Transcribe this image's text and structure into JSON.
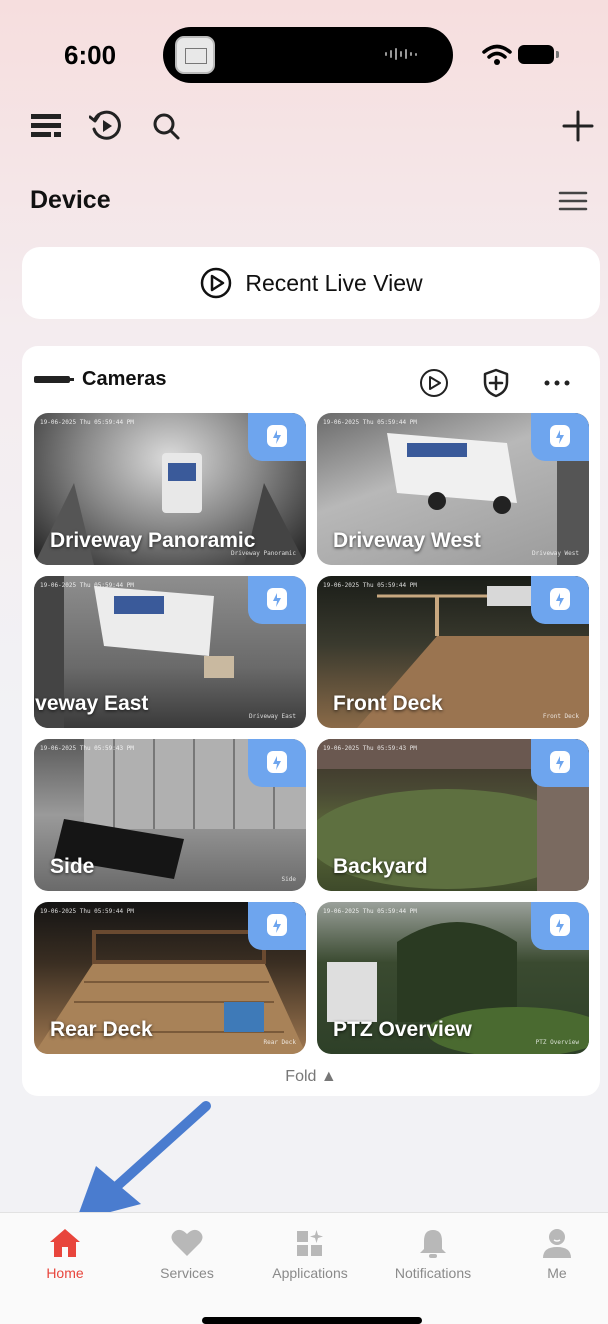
{
  "status_bar": {
    "time": "6:00"
  },
  "header": {
    "device_title": "Device"
  },
  "recent_live_view": {
    "label": "Recent Live View"
  },
  "cameras": {
    "title": "Cameras",
    "fold_label": "Fold ▲",
    "items": [
      {
        "name": "Driveway Panoramic",
        "timestamp": "19-06-2025 Thu 05:59:44 PM",
        "watermark": "Driveway Panoramic"
      },
      {
        "name": "Driveway West",
        "timestamp": "19-06-2025 Thu 05:59:44 PM",
        "watermark": "Driveway West"
      },
      {
        "name": "Driveway East",
        "timestamp": "19-06-2025 Thu 05:59:44 PM",
        "watermark": "Driveway East"
      },
      {
        "name": "Front Deck",
        "timestamp": "19-06-2025 Thu 05:59:44 PM",
        "watermark": "Front Deck"
      },
      {
        "name": "Side",
        "timestamp": "19-06-2025 Thu 05:59:43 PM",
        "watermark": "Side"
      },
      {
        "name": "Backyard",
        "timestamp": "19-06-2025 Thu 05:59:43 PM",
        "watermark": ""
      },
      {
        "name": "Rear Deck",
        "timestamp": "19-06-2025 Thu 05:59:44 PM",
        "watermark": "Rear Deck"
      },
      {
        "name": "PTZ Overview",
        "timestamp": "19-06-2025 Thu 05:59:44 PM",
        "watermark": "PTZ Overview"
      }
    ]
  },
  "tabbar": {
    "items": [
      {
        "label": "Home",
        "icon": "home-icon",
        "active": true
      },
      {
        "label": "Services",
        "icon": "heart-icon",
        "active": false
      },
      {
        "label": "Applications",
        "icon": "apps-grid-icon",
        "active": false
      },
      {
        "label": "Notifications",
        "icon": "bell-icon",
        "active": false
      },
      {
        "label": "Me",
        "icon": "person-icon",
        "active": false
      }
    ]
  },
  "colors": {
    "accent_active": "#e8453c",
    "badge_blue": "#6ea5ee",
    "annotation_arrow": "#4a7ccf",
    "inactive_tab": "#8a8a8a"
  }
}
